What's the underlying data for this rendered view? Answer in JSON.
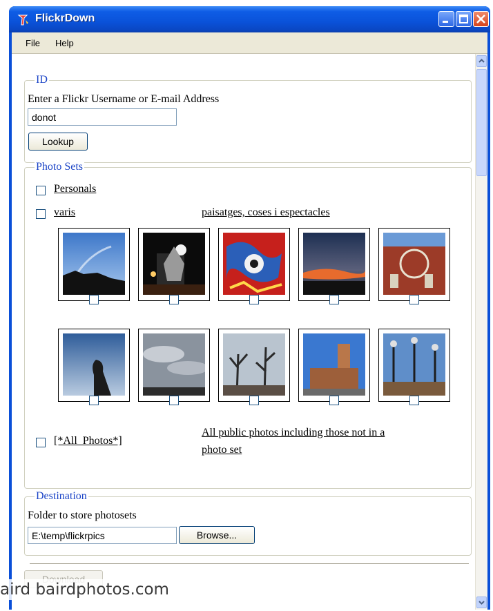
{
  "window": {
    "title": "FlickrDown",
    "controls": {
      "minimize": "minimize",
      "maximize": "maximize",
      "close": "close"
    }
  },
  "menu": [
    "File",
    "Help"
  ],
  "id_group": {
    "legend": "ID",
    "prompt": "Enter a Flickr Username or E-mail Address",
    "username_value": "donot",
    "lookup_label": "Lookup"
  },
  "photosets": {
    "legend": "Photo Sets",
    "sets": [
      {
        "name": "Personals",
        "description": ""
      },
      {
        "name": "varis",
        "description": "paisatges, coses i espectacles"
      }
    ],
    "thumbnails": [
      {
        "subject": "sky-silhouette",
        "checked": false
      },
      {
        "subject": "stage-lights",
        "checked": false
      },
      {
        "subject": "red-mosaic",
        "checked": false
      },
      {
        "subject": "sunset-clouds",
        "checked": false
      },
      {
        "subject": "brick-building",
        "checked": false
      },
      {
        "subject": "statue-silhouette",
        "checked": false
      },
      {
        "subject": "cloudy-sky",
        "checked": false
      },
      {
        "subject": "winter-trees",
        "checked": false
      },
      {
        "subject": "monastery-tower",
        "checked": false
      },
      {
        "subject": "street-lamps",
        "checked": false
      }
    ],
    "all_photos": {
      "name": "[*All_Photos*]",
      "description_line1": "All public photos including those not in a",
      "description_line2": "photo set"
    }
  },
  "destination": {
    "legend": "Destination",
    "prompt": "Folder to store photosets",
    "path_value": "E:\\temp\\flickrpics",
    "browse_label": "Browse..."
  },
  "download_label": "Download",
  "watermark": "aird bairdphotos.com",
  "colors": {
    "accent": "#1c45c7",
    "titlebar": "#0a52d9",
    "face": "#ece9d8"
  }
}
